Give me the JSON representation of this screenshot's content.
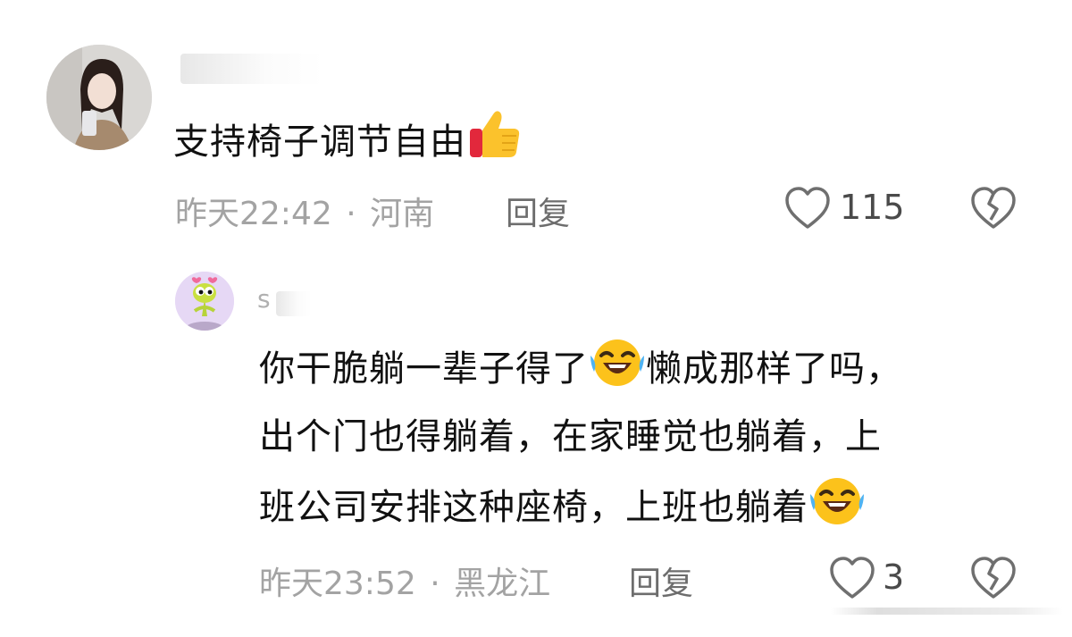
{
  "comments": [
    {
      "user": {
        "name_visible": ""
      },
      "text": "支持椅子调节自由",
      "emoji": "thumbs-up",
      "time": "昨天22:42",
      "sep": "·",
      "location": "河南",
      "reply_label": "回复",
      "like_count": "115"
    },
    {
      "user": {
        "name_visible": "s"
      },
      "text_line1": "你干脆躺一辈子得了",
      "text_line1b": "懒成那样了吗，",
      "text_line2": "出个门也得躺着，在家睡觉也躺着，上",
      "text_line3": "班公司安排这种座椅，上班也躺着",
      "emoji": "laughing-tears",
      "time": "昨天23:52",
      "sep": "·",
      "location": "黑龙江",
      "reply_label": "回复",
      "like_count": "3"
    }
  ],
  "colors": {
    "meta_gray": "#a3a3a3",
    "reply_gray": "#6d6d6d",
    "icon_gray": "#6f6f6f"
  }
}
